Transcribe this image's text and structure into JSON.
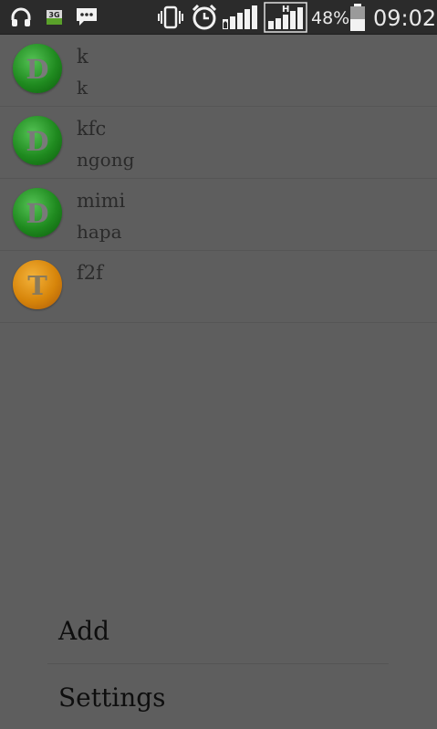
{
  "status_bar": {
    "network_badge": "3G",
    "hspa_badge": "H",
    "battery_percent": "48%",
    "battery_level": 0.48,
    "time": "09:02",
    "icons": [
      "headphones-icon",
      "sim-3g-icon",
      "message-icon",
      "vibrate-icon",
      "alarm-icon",
      "signal-icon",
      "hspa-signal-icon",
      "battery-icon"
    ]
  },
  "contacts": [
    {
      "initial": "D",
      "name": "k",
      "subtitle": "k",
      "color": "green"
    },
    {
      "initial": "D",
      "name": "kfc",
      "subtitle": "ngong",
      "color": "green"
    },
    {
      "initial": "D",
      "name": "mimi",
      "subtitle": "hapa",
      "color": "green"
    },
    {
      "initial": "T",
      "name": "f2f",
      "subtitle": "",
      "color": "orange"
    }
  ],
  "menu": {
    "add_label": "Add",
    "settings_label": "Settings"
  },
  "colors": {
    "background": "#5e5e5e",
    "status_bar": "#2b2b2b",
    "avatar_green": "#1f8a1f",
    "avatar_orange": "#d7850a"
  }
}
